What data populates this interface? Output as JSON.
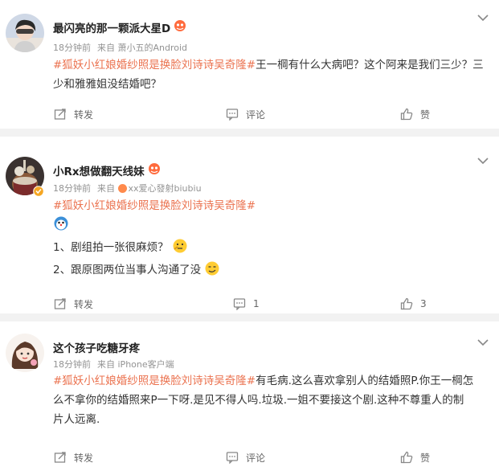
{
  "comments": [
    {
      "username": "最闪亮的那一颗派大星D",
      "time": "18分钟前",
      "from_prefix": "来自",
      "source": "萧小五的Android",
      "hashtag": "#狐妖小红娘婚纱照是换脸刘诗诗吴奇隆#",
      "text": "王一棡有什么大病吧？这个阿来是我们三少？三少和雅雅姐没结婚吧？",
      "repost_label": "转发",
      "comment_label": "评论",
      "like_label": "赞"
    },
    {
      "username": "小Rx想做翻天线妹",
      "time": "18分钟前",
      "from_prefix": "来自",
      "source": "xx爱心發射biubiu",
      "hashtag": "#狐妖小红娘婚纱照是换脸刘诗诗吴奇隆#",
      "line1": "1、剧组拍一张很麻烦？",
      "line2": "2、跟原图两位当事人沟通了没",
      "repost_label": "转发",
      "comment_count": "1",
      "like_count": "3"
    },
    {
      "username": "这个孩子吃糖牙疼",
      "time": "18分钟前",
      "from_prefix": "来自",
      "source": "iPhone客户端",
      "hashtag": "#狐妖小红娘婚纱照是换脸刘诗诗吴奇隆#",
      "text_line1_rest": "有毛病.这么喜欢拿别人的结婚照P.你王一棡怎",
      "text_line2": "么不拿你的结婚照来P一下呀.是见不得人吗.垃圾.一姐不要接这个剧.这种不尊重人的制",
      "text_line3": "片人远离.",
      "repost_label": "转发",
      "comment_label": "评论",
      "like_label": "赞"
    }
  ],
  "colors": {
    "hashtag": "#eb7350",
    "vip_badge": "#ff6b3d",
    "verified_badge": "#f5a623",
    "meta_text": "#939393",
    "background": "#f2f2f2"
  }
}
